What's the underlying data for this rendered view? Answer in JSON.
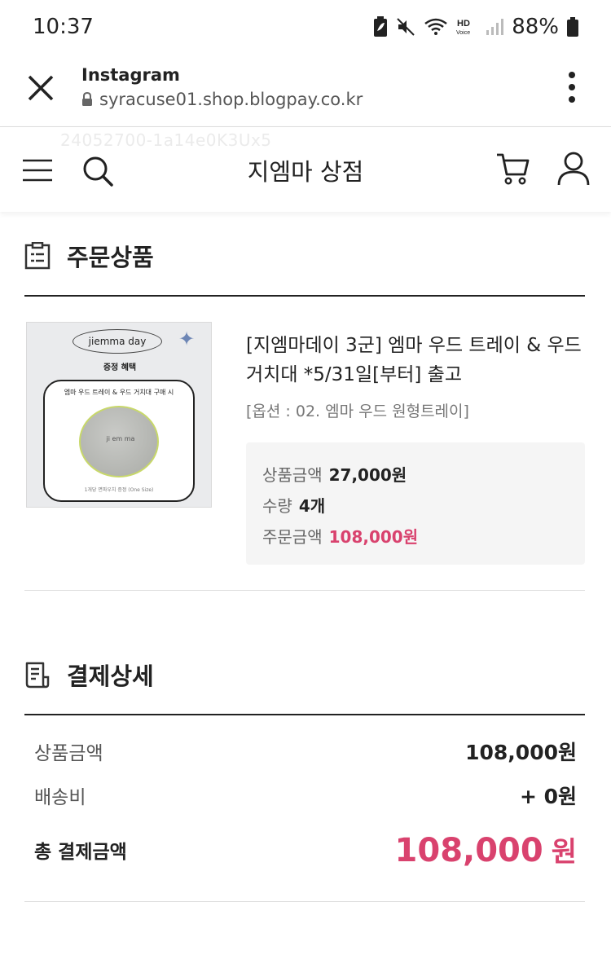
{
  "status_bar": {
    "time": "10:37",
    "battery": "88%"
  },
  "browser": {
    "app_name": "Instagram",
    "url": "syracuse01.shop.blogpay.co.kr"
  },
  "watermark_id": "24052700-1a14e0K3Ux5",
  "shop": {
    "title": "지엠마 상점"
  },
  "order_section": {
    "title": "주문상품",
    "product": {
      "thumb": {
        "brand": "jiemma day",
        "subtitle": "증정 혜택",
        "box_text": "엠마 우드 트레이 & 우드 거치대 구매 시",
        "bag_label": "ji em ma",
        "foot": "1개당 면파우치 증정 (One Size)"
      },
      "name": "[지엠마데이 3군] 엠마 우드 트레이 & 우드 거치대 *5/31일[부터] 출고",
      "option": "[옵션 : 02. 엠마 우드 원형트레이]",
      "unit_price_label": "상품금액",
      "unit_price": "27,000원",
      "quantity_label": "수량",
      "quantity": "4개",
      "order_amount_label": "주문금액",
      "order_amount": "108,000원"
    }
  },
  "payment_section": {
    "title": "결제상세",
    "product_amount_label": "상품금액",
    "product_amount": "108,000원",
    "shipping_label": "배송비",
    "shipping": "+ 0원",
    "total_label": "총 결제금액",
    "total_value": "108,000",
    "total_unit": "원"
  },
  "colors": {
    "accent": "#d9426e",
    "text": "#222222",
    "muted": "#777777",
    "price_box_bg": "#f5f5f5"
  }
}
